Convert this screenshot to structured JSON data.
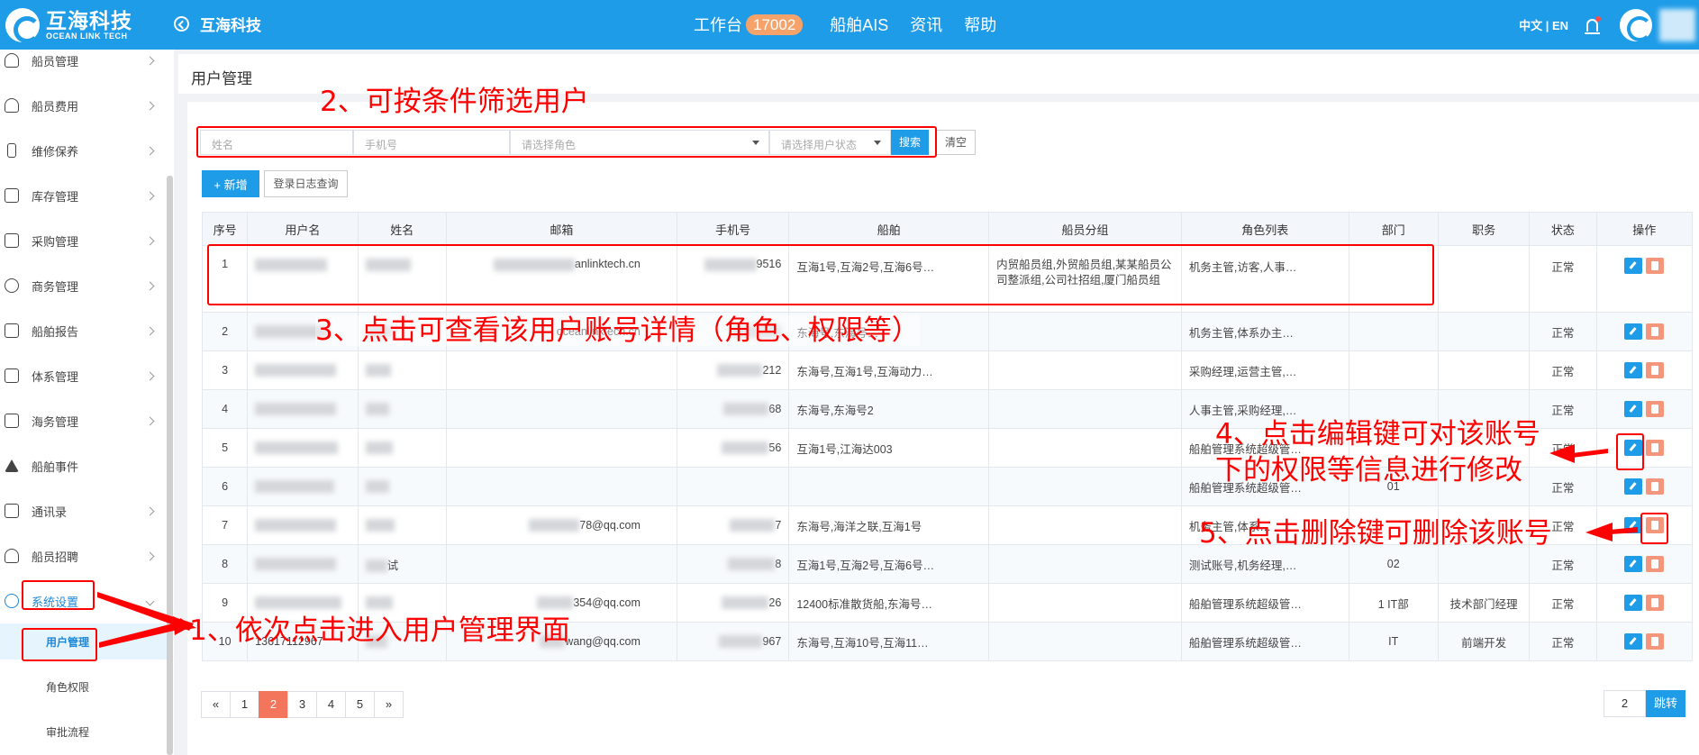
{
  "header": {
    "logo_cn": "互海科技",
    "logo_en": "OCEAN LINK TECH",
    "back_label": "互海科技",
    "nav": [
      {
        "label": "工作台",
        "badge": "17002"
      },
      {
        "label": "船舶AIS"
      },
      {
        "label": "资讯"
      },
      {
        "label": "帮助"
      }
    ],
    "lang": "中文 | EN"
  },
  "sidebar": {
    "items": [
      {
        "label": "船员管理",
        "icon": "crew-icon"
      },
      {
        "label": "船员费用",
        "icon": "crew-fee-icon"
      },
      {
        "label": "维修保养",
        "icon": "wrench-icon"
      },
      {
        "label": "库存管理",
        "icon": "inventory-icon"
      },
      {
        "label": "采购管理",
        "icon": "purchase-icon"
      },
      {
        "label": "商务管理",
        "icon": "globe-icon"
      },
      {
        "label": "船舶报告",
        "icon": "calendar-icon"
      },
      {
        "label": "体系管理",
        "icon": "document-icon"
      },
      {
        "label": "海务管理",
        "icon": "sign-icon"
      },
      {
        "label": "船舶事件",
        "icon": "warning-icon"
      },
      {
        "label": "通讯录",
        "icon": "contacts-icon"
      },
      {
        "label": "船员招聘",
        "icon": "recruit-icon"
      },
      {
        "label": "系统设置",
        "icon": "gear-icon"
      }
    ],
    "sub_items": [
      "用户管理",
      "角色权限",
      "审批流程"
    ]
  },
  "page": {
    "title": "用户管理",
    "filters": {
      "name_placeholder": "姓名",
      "phone_placeholder": "手机号",
      "role_placeholder": "请选择角色",
      "status_placeholder": "请选择用户状态",
      "search_label": "搜索",
      "clear_label": "清空"
    },
    "add_label": "+ 新增",
    "log_label": "登录日志查询"
  },
  "table": {
    "columns": [
      "序号",
      "用户名",
      "姓名",
      "邮箱",
      "手机号",
      "船舶",
      "船员分组",
      "角色列表",
      "部门",
      "职务",
      "状态",
      "操作"
    ],
    "rows": [
      {
        "no": "1",
        "username": "",
        "name": "",
        "email": "anlinktech.cn",
        "phone": "9516",
        "ships": "互海1号,互海2号,互海6号…",
        "group": "内贸船员组,外贸船员组,某某船员公司整派组,公司社招组,厦门船员组",
        "roles": "机务主管,访客,人事…",
        "dept": "",
        "title": "",
        "status": "正常"
      },
      {
        "no": "2",
        "username": "",
        "name": "",
        "email": "oceanlinktech.cn",
        "phone": "",
        "ships": "东海号,东海号…",
        "group": "",
        "roles": "机务主管,体系办主…",
        "dept": "",
        "title": "",
        "status": "正常"
      },
      {
        "no": "3",
        "username": "",
        "name": "",
        "email": "",
        "phone": "212",
        "ships": "东海号,互海1号,互海动力…",
        "group": "",
        "roles": "采购经理,运营主管,…",
        "dept": "",
        "title": "",
        "status": "正常"
      },
      {
        "no": "4",
        "username": "",
        "name": "",
        "email": "",
        "phone": "68",
        "ships": "东海号,东海号2",
        "group": "",
        "roles": "人事主管,采购经理,…",
        "dept": "",
        "title": "",
        "status": "正常"
      },
      {
        "no": "5",
        "username": "",
        "name": "",
        "email": "",
        "phone": "56",
        "ships": "互海1号,江海达003",
        "group": "",
        "roles": "船舶管理系统超级管…",
        "dept": "",
        "title": "",
        "status": "正常"
      },
      {
        "no": "6",
        "username": "",
        "name": "",
        "email": "",
        "phone": "",
        "ships": "",
        "group": "",
        "roles": "船舶管理系统超级管…",
        "dept": "01",
        "title": "",
        "status": "正常"
      },
      {
        "no": "7",
        "username": "",
        "name": "",
        "email": "78@qq.com",
        "phone": "7",
        "ships": "东海号,海洋之联,互海1号",
        "group": "",
        "roles": "机务主管,体系…",
        "dept": "",
        "title": "",
        "status": "正常"
      },
      {
        "no": "8",
        "username": "",
        "name": "试",
        "email": "",
        "phone": "8",
        "ships": "互海1号,互海2号,互海6号…",
        "group": "",
        "roles": "测试账号,机务经理,…",
        "dept": "02",
        "title": "",
        "status": "正常"
      },
      {
        "no": "9",
        "username": "",
        "name": "",
        "email": "354@qq.com",
        "phone": "26",
        "ships": "12400标准散货船,东海号…",
        "group": "",
        "roles": "船舶管理系统超级管…",
        "dept": "1 IT部",
        "title": "技术部门经理",
        "status": "正常"
      },
      {
        "no": "10",
        "username": "13617112967",
        "name": "",
        "email": "wang@qq.com",
        "phone": "967",
        "ships": "东海号,互海10号,互海11…",
        "group": "",
        "roles": "船舶管理系统超级管…",
        "dept": "IT",
        "title": "前端开发",
        "status": "正常"
      }
    ]
  },
  "pagination": {
    "pages": [
      "«",
      "1",
      "2",
      "3",
      "4",
      "5",
      "»"
    ],
    "current": "2",
    "jump_value": "2",
    "jump_label": "跳转"
  },
  "annotations": {
    "a1": "1、依次点击进入用户管理界面",
    "a2": "2、可按条件筛选用户",
    "a3": "3、点击可查看该用户账号详情（角色、权限等）",
    "a4_line1": "4、点击编辑键可对该账号",
    "a4_line2": "下的权限等信息进行修改",
    "a5": "5、点击删除键可删除该账号"
  },
  "colors": {
    "primary": "#1e9ce8",
    "danger": "#f3967c",
    "annotation": "#ff0000",
    "badge": "#f5a36a"
  }
}
